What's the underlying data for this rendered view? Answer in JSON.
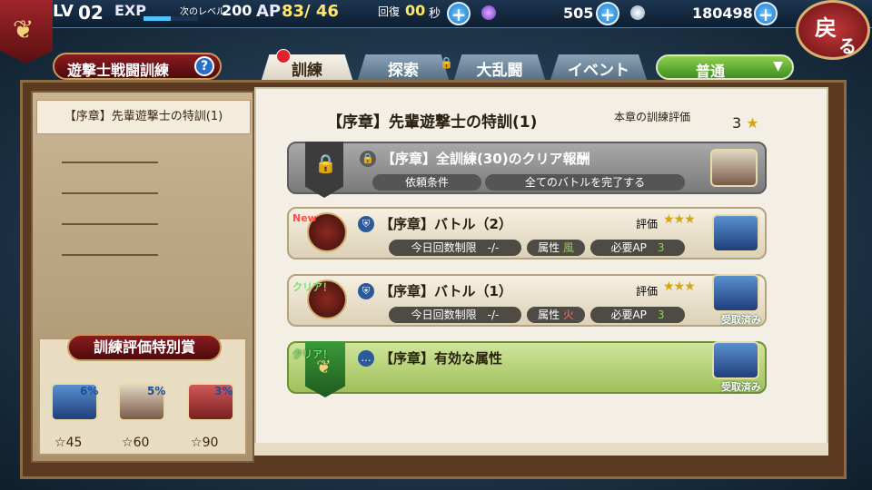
{
  "topbar": {
    "lv_label": "LV",
    "lv_value": "02",
    "exp_label": "EXP",
    "next_level_label": "次のレベル",
    "next_level_value": "200",
    "ap_label": "AP",
    "ap_value": "83/ 46",
    "recover_label": "回復",
    "recover_value": "00",
    "recover_unit": "秒",
    "gem_count": "505",
    "coin_count": "180498",
    "exp_fraction": 0.5
  },
  "back_button": {
    "line1": "戻",
    "line2": "る"
  },
  "left": {
    "title": "遊撃士戦闘訓練",
    "help": "?",
    "chapter_item": "【序章】先輩遊撃士の特訓(1)",
    "reward_title": "訓練評価特別賞",
    "rewards": [
      {
        "pct": "6%",
        "stars": "45"
      },
      {
        "pct": "5%",
        "stars": "60"
      },
      {
        "pct": "3%",
        "stars": "90"
      }
    ]
  },
  "tabs": [
    {
      "label": "訓練",
      "active": true
    },
    {
      "label": "探索",
      "active": false
    },
    {
      "label": "大乱闘",
      "active": false
    },
    {
      "label": "イベント",
      "active": false
    }
  ],
  "dropdown": {
    "label": "普通"
  },
  "content": {
    "chapter_title": "【序章】先輩遊撃士の特訓(1)",
    "eval_label": "本章の訓練評価",
    "eval_value": "3",
    "rows": [
      {
        "title": "【序章】全訓練(30)のクリア報酬",
        "cond_label": "依頼条件",
        "cond_value": "全てのバトルを完了する"
      },
      {
        "badge": "New",
        "title": "【序章】バトル（2）",
        "eval_label": "評価",
        "limit_label": "今日回数制限",
        "limit_value": "-/-",
        "attr_label": "属性",
        "attr_icon": "風",
        "ap_label": "必要AP",
        "ap_value": "3"
      },
      {
        "badge": "クリア！",
        "title": "【序章】バトル（1）",
        "eval_label": "評価",
        "limit_label": "今日回数制限",
        "limit_value": "-/-",
        "attr_label": "属性",
        "attr_icon": "火",
        "ap_label": "必要AP",
        "ap_value": "3",
        "received": "受取済み"
      },
      {
        "badge": "クリア！",
        "title": "【序章】有効な属性",
        "received": "受取済み"
      }
    ]
  },
  "colors": {
    "accent_red": "#8a1c20",
    "green_dropdown": "#3f8e1f",
    "blue_plus": "#1a78c8"
  }
}
